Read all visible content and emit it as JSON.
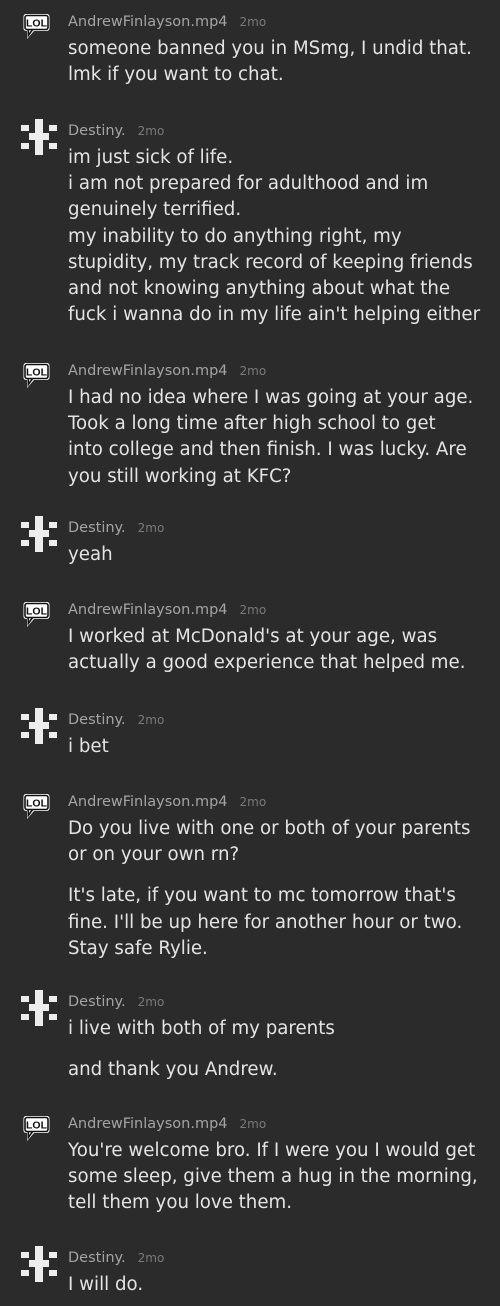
{
  "messages": [
    {
      "author": "AndrewFinlayson.mp4",
      "avatar": "lol-speech-bubble-icon",
      "time": "2mo",
      "paragraphs": [
        [
          "someone banned you in MSmg, I undid that.",
          "lmk if you want to chat."
        ]
      ]
    },
    {
      "author": "Destiny.",
      "avatar": "hash-grid-icon",
      "time": "2mo",
      "paragraphs": [
        [
          "im just sick of life.",
          "i am not prepared for adulthood and im",
          "genuinely terrified.",
          "my inability to do anything right, my",
          "stupidity, my track record of keeping friends",
          "and not knowing anything about what the",
          "fuck i wanna do in my life ain't helping either"
        ]
      ]
    },
    {
      "author": "AndrewFinlayson.mp4",
      "avatar": "lol-speech-bubble-icon",
      "time": "2mo",
      "paragraphs": [
        [
          "I had no idea where I was going at your age.",
          "Took a long time after high school to get",
          "into college and then finish. I was lucky. Are",
          "you still working at KFC?"
        ]
      ]
    },
    {
      "author": "Destiny.",
      "avatar": "hash-grid-icon",
      "time": "2mo",
      "paragraphs": [
        [
          "yeah"
        ]
      ]
    },
    {
      "author": "AndrewFinlayson.mp4",
      "avatar": "lol-speech-bubble-icon",
      "time": "2mo",
      "paragraphs": [
        [
          "I worked at McDonald's at your age, was",
          "actually a good experience that helped me."
        ]
      ]
    },
    {
      "author": "Destiny.",
      "avatar": "hash-grid-icon",
      "time": "2mo",
      "paragraphs": [
        [
          "i bet"
        ]
      ]
    },
    {
      "author": "AndrewFinlayson.mp4",
      "avatar": "lol-speech-bubble-icon",
      "time": "2mo",
      "paragraphs": [
        [
          "Do you live with one or both of your parents",
          "or on your own rn?"
        ],
        [
          "It's late, if you want to mc tomorrow that's",
          "fine. I'll be up here for another hour or two.",
          "Stay safe Rylie."
        ]
      ]
    },
    {
      "author": "Destiny.",
      "avatar": "hash-grid-icon",
      "time": "2mo",
      "paragraphs": [
        [
          "i live with both of my parents"
        ],
        [
          "and thank you Andrew."
        ]
      ]
    },
    {
      "author": "AndrewFinlayson.mp4",
      "avatar": "lol-speech-bubble-icon",
      "time": "2mo",
      "paragraphs": [
        [
          "You're welcome bro. If I were you I would get",
          "some sleep, give them a hug in the morning,",
          "tell them you love them."
        ]
      ]
    },
    {
      "author": "Destiny.",
      "avatar": "hash-grid-icon",
      "time": "2mo",
      "paragraphs": [
        [
          "I will do."
        ]
      ]
    }
  ]
}
